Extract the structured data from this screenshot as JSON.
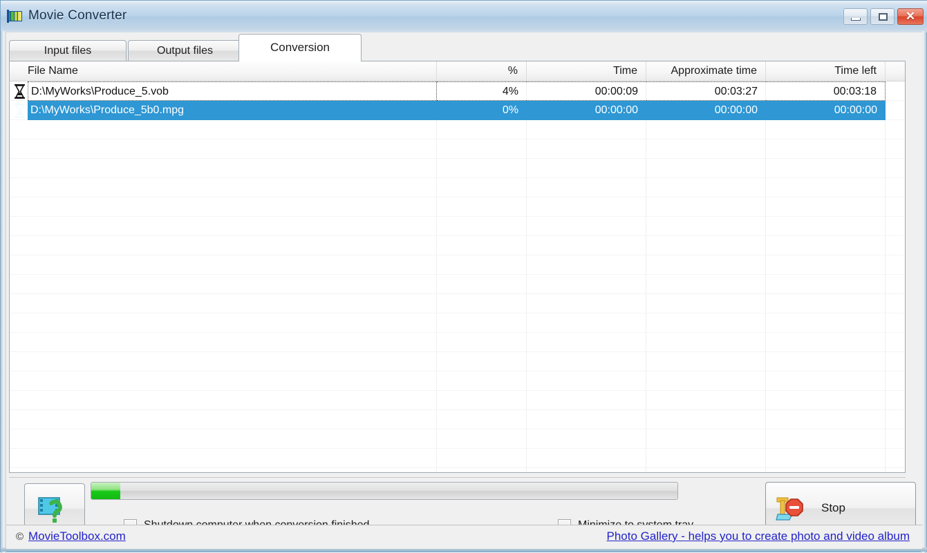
{
  "window": {
    "title": "Movie Converter",
    "app_icon": "movie-converter-icon",
    "minimize_label": "—",
    "maximize_label": "□",
    "close_label": "✕"
  },
  "tabs": [
    {
      "label": "Input files",
      "active": false
    },
    {
      "label": "Output files",
      "active": false
    },
    {
      "label": "Conversion",
      "active": true
    }
  ],
  "list": {
    "columns": [
      {
        "key": "file",
        "label": "File Name",
        "align": "left"
      },
      {
        "key": "pct",
        "label": "%",
        "align": "right"
      },
      {
        "key": "time",
        "label": "Time",
        "align": "right"
      },
      {
        "key": "appx",
        "label": "Approximate time",
        "align": "right"
      },
      {
        "key": "left",
        "label": "Time left",
        "align": "right"
      }
    ],
    "rows": [
      {
        "icon": "hourglass-icon",
        "file": "D:\\MyWorks\\Produce_5.vob",
        "pct": "4%",
        "time": "00:00:09",
        "appx": "00:03:27",
        "left": "00:03:18",
        "selected": false,
        "focused": true
      },
      {
        "icon": "hourglass-icon",
        "file": "D:\\MyWorks\\Produce_5b0.mpg",
        "pct": "0%",
        "time": "00:00:00",
        "appx": "00:00:00",
        "left": "00:00:00",
        "selected": true,
        "focused": false
      }
    ]
  },
  "controls": {
    "help_icon": "film-question-help-icon",
    "progress": {
      "percent": 5,
      "fill_color": "#19c919"
    },
    "shutdown_checkbox": {
      "label": "Shutdown computer when conversion finished",
      "checked": false
    },
    "tray_checkbox": {
      "label": "Minimize to system tray",
      "checked": false
    },
    "stop_button": {
      "label": "Stop",
      "icon": "stop-sign-icon"
    }
  },
  "statusbar": {
    "copyright_symbol": "©",
    "site_link": "MovieToolbox.com",
    "gallery_link": "Photo Gallery - helps you to create photo and video album"
  },
  "colors": {
    "selection": "#2e97d4",
    "link": "#2323c8",
    "progress": "#19c919",
    "title_text": "#17304a"
  }
}
